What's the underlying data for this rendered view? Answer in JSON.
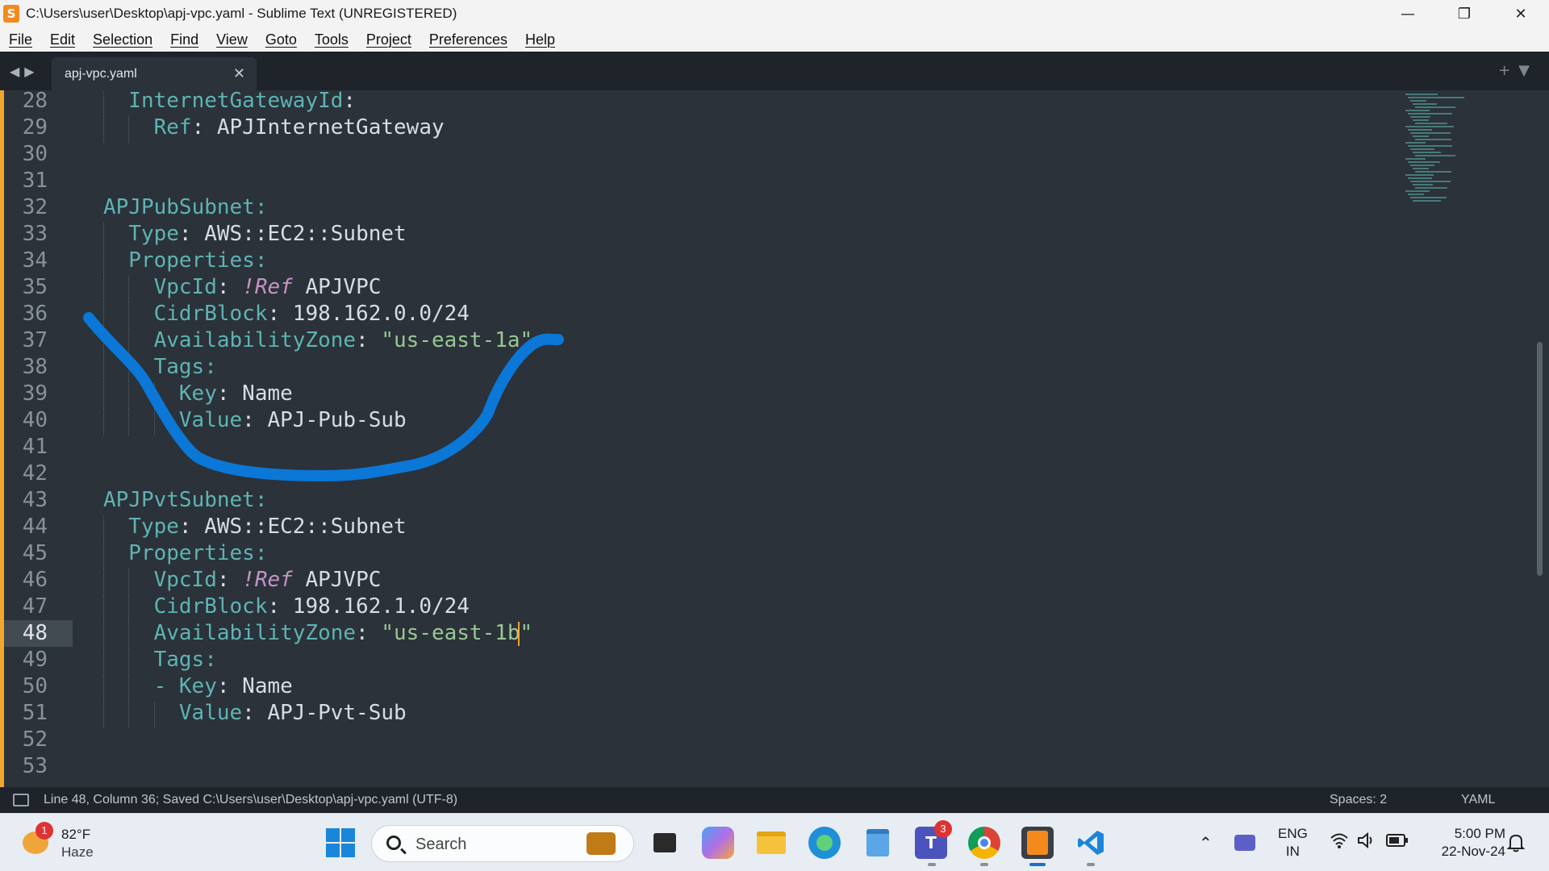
{
  "window": {
    "title": "C:\\Users\\user\\Desktop\\apj-vpc.yaml - Sublime Text (UNREGISTERED)",
    "app_icon_glyph": "S",
    "controls": {
      "minimize": "—",
      "maximize": "❐",
      "close": "✕"
    }
  },
  "menu": [
    "File",
    "Edit",
    "Selection",
    "Find",
    "View",
    "Goto",
    "Tools",
    "Project",
    "Preferences",
    "Help"
  ],
  "tabs": {
    "nav_arrows": "◀▶",
    "active": {
      "label": "apj-vpc.yaml",
      "close": "✕"
    },
    "right_controls": "+▼"
  },
  "editor": {
    "current_line": 48,
    "annotation_color": "#0b77d6",
    "lines": [
      {
        "n": "28",
        "parts": [
          {
            "c": "k",
            "t": "InternetGatewayId"
          },
          {
            "c": "v",
            "t": ":"
          }
        ]
      },
      {
        "n": "29",
        "parts": [
          {
            "c": "k",
            "t": "Ref"
          },
          {
            "c": "v",
            "t": ": APJInternetGateway"
          }
        ]
      },
      {
        "n": "30",
        "parts": []
      },
      {
        "n": "31",
        "parts": []
      },
      {
        "n": "32",
        "parts": [
          {
            "c": "k",
            "t": "APJPubSubnet"
          },
          {
            "c": "k",
            "t": ":"
          }
        ]
      },
      {
        "n": "33",
        "parts": [
          {
            "c": "k",
            "t": "Type"
          },
          {
            "c": "v",
            "t": ": AWS::EC2::Subnet"
          }
        ]
      },
      {
        "n": "34",
        "parts": [
          {
            "c": "k",
            "t": "Properties"
          },
          {
            "c": "k",
            "t": ":"
          }
        ]
      },
      {
        "n": "35",
        "parts": [
          {
            "c": "k",
            "t": "VpcId"
          },
          {
            "c": "v",
            "t": ": "
          },
          {
            "c": "tag",
            "t": "!Ref"
          },
          {
            "c": "v",
            "t": " APJVPC"
          }
        ]
      },
      {
        "n": "36",
        "parts": [
          {
            "c": "k",
            "t": "CidrBlock"
          },
          {
            "c": "v",
            "t": ": 198.162.0.0/24"
          }
        ]
      },
      {
        "n": "37",
        "parts": [
          {
            "c": "k",
            "t": "AvailabilityZone"
          },
          {
            "c": "v",
            "t": ": "
          },
          {
            "c": "s",
            "t": "\"us-east-1a\""
          }
        ]
      },
      {
        "n": "38",
        "parts": [
          {
            "c": "k",
            "t": "Tags"
          },
          {
            "c": "k",
            "t": ":"
          }
        ]
      },
      {
        "n": "39",
        "parts": [
          {
            "c": "k",
            "t": "Key"
          },
          {
            "c": "v",
            "t": ": Name"
          }
        ]
      },
      {
        "n": "40",
        "parts": [
          {
            "c": "k",
            "t": "Value"
          },
          {
            "c": "v",
            "t": ": APJ-Pub-Sub"
          }
        ]
      },
      {
        "n": "41",
        "parts": []
      },
      {
        "n": "42",
        "parts": []
      },
      {
        "n": "43",
        "parts": [
          {
            "c": "k",
            "t": "APJPvtSubnet"
          },
          {
            "c": "k",
            "t": ":"
          }
        ]
      },
      {
        "n": "44",
        "parts": [
          {
            "c": "k",
            "t": "Type"
          },
          {
            "c": "v",
            "t": ": AWS::EC2::Subnet"
          }
        ]
      },
      {
        "n": "45",
        "parts": [
          {
            "c": "k",
            "t": "Properties"
          },
          {
            "c": "k",
            "t": ":"
          }
        ]
      },
      {
        "n": "46",
        "parts": [
          {
            "c": "k",
            "t": "VpcId"
          },
          {
            "c": "v",
            "t": ": "
          },
          {
            "c": "tag",
            "t": "!Ref"
          },
          {
            "c": "v",
            "t": " APJVPC"
          }
        ]
      },
      {
        "n": "47",
        "parts": [
          {
            "c": "k",
            "t": "CidrBlock"
          },
          {
            "c": "v",
            "t": ": 198.162.1.0/24"
          }
        ]
      },
      {
        "n": "48",
        "parts": [
          {
            "c": "k",
            "t": "AvailabilityZone"
          },
          {
            "c": "v",
            "t": ": "
          },
          {
            "c": "s",
            "t": "\"us-east-1b\""
          }
        ]
      },
      {
        "n": "49",
        "parts": [
          {
            "c": "k",
            "t": "Tags"
          },
          {
            "c": "k",
            "t": ":"
          }
        ]
      },
      {
        "n": "50",
        "parts": [
          {
            "c": "d",
            "t": "- "
          },
          {
            "c": "k",
            "t": "Key"
          },
          {
            "c": "v",
            "t": ": Name"
          }
        ]
      },
      {
        "n": "51",
        "parts": [
          {
            "c": "k",
            "t": "Value"
          },
          {
            "c": "v",
            "t": ": APJ-Pvt-Sub"
          }
        ]
      },
      {
        "n": "52",
        "parts": []
      },
      {
        "n": "53",
        "parts": []
      }
    ]
  },
  "status": {
    "left": "Line 48, Column 36; Saved C:\\Users\\user\\Desktop\\apj-vpc.yaml (UTF-8)",
    "spaces": "Spaces: 2",
    "syntax": "YAML"
  },
  "taskbar": {
    "weather": {
      "temp": "82°F",
      "desc": "Haze",
      "badge": "1"
    },
    "search_placeholder": "Search",
    "teams_badge": "3",
    "language": {
      "line1": "ENG",
      "line2": "IN"
    },
    "clock": {
      "time": "5:00 PM",
      "date": "22-Nov-24"
    }
  }
}
